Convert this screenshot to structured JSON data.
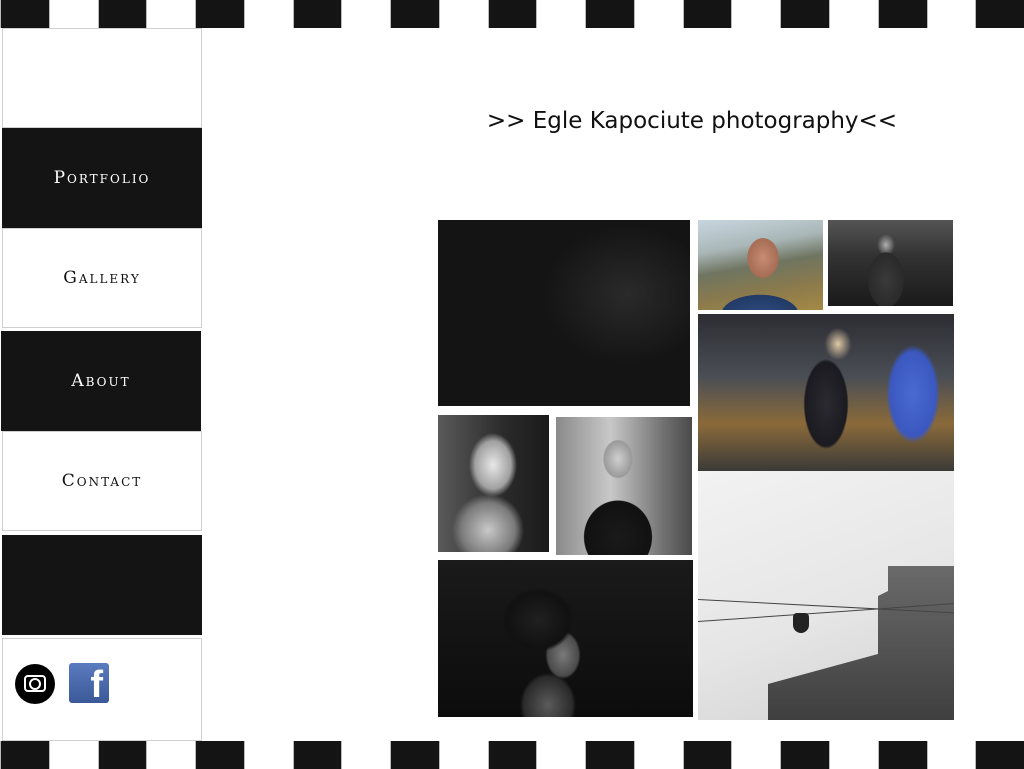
{
  "site": {
    "title": ">> Egle Kapociute photography<<"
  },
  "nav": {
    "items": [
      {
        "label": "Portfolio"
      },
      {
        "label": "Gallery"
      },
      {
        "label": "About"
      },
      {
        "label": "Contact"
      }
    ]
  },
  "social": {
    "icons": [
      "instagram-icon",
      "facebook-icon"
    ],
    "facebook_glyph": "f"
  },
  "gallery": {
    "photos": [
      "woman-closeup-bw",
      "man-mountain-color",
      "boy-crowd-bw",
      "woman-bicycle-color",
      "statue-bw",
      "man-street-bw",
      "shoe-wires-building-bw",
      "curly-hair-woman-bw"
    ]
  },
  "colors": {
    "strip_dark": "#141414",
    "facebook_blue": "#3b5998"
  }
}
